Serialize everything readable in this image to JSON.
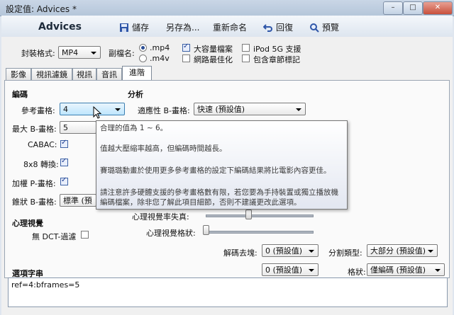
{
  "window": {
    "title": "設定值: Advices *",
    "min": "–",
    "max": "□",
    "close": "✕"
  },
  "toolbar": {
    "brand": "Advices",
    "save": "儲存",
    "save_as": "另存為...",
    "rename": "重新命名",
    "revert": "回復",
    "preview": "預覽"
  },
  "top": {
    "format_label": "封裝格式:",
    "format_value": "MP4",
    "ext_label": "副檔名:",
    "ext_options": [
      ".mp4",
      ".m4v"
    ],
    "ext_selected": ".mp4",
    "large_file": "大容量檔案",
    "web_opt": "網路最佳化",
    "ipod": "iPod 5G 支援",
    "chapters": "包含章節標記"
  },
  "tabs": [
    "影像",
    "視訊濾鏡",
    "視訊",
    "音訊",
    "進階"
  ],
  "active_tab": "進階",
  "encoding": {
    "section": "編碼",
    "ref_frames_label": "參考畫格:",
    "ref_frames_value": "4",
    "max_b_label": "最大 B-畫格:",
    "max_b_value": "5",
    "cabac_label": "CABAC:",
    "t8x8_label": "8x8 轉換:",
    "weighted_p_label": "加權 P-畫格:",
    "pyramid_b_label": "錐狀 B-畫格:",
    "pyramid_b_value": "標準 (預設"
  },
  "analysis": {
    "section": "分析",
    "adaptive_b_label": "適應性 B-畫格:",
    "adaptive_b_value": "快速 (預設值)"
  },
  "psy": {
    "section": "心理視覺",
    "no_dct_label": "無 DCT-過濾",
    "rd_label": "心理視覺率失真:",
    "trellis_label": "心理視覺格狀:"
  },
  "bottom": {
    "deblock_label": "解碼去塊:",
    "deblock_a": "0 (預設值)",
    "deblock_b": "0 (預設值)",
    "partition_label": "分割類型:",
    "partition_value": "大部分 (預設值)",
    "trellis2_label": "格狀:",
    "trellis2_value": "僅編碼 (預設值)"
  },
  "options_string": {
    "label": "選項字串",
    "value": "ref=4:bframes=5"
  },
  "tooltip": {
    "line1": "合理的值為 1 ~ 6。",
    "line2": "值越大壓縮率越高，但編碼時間越長。",
    "line3": "賽璐璐動畫於使用更多參考畫格的設定下編碼結果將比電影內容更佳。",
    "line4": "請注意許多硬體支援的參考畫格數有限，若您要為手持裝置或獨立播放機編碼檔案，除非您了解此項目細節，否則不建議更改此選項。"
  },
  "colors": {
    "accent": "#2a4d94",
    "title_bar": "#c1cfe1",
    "panel": "#f0f0f0"
  }
}
